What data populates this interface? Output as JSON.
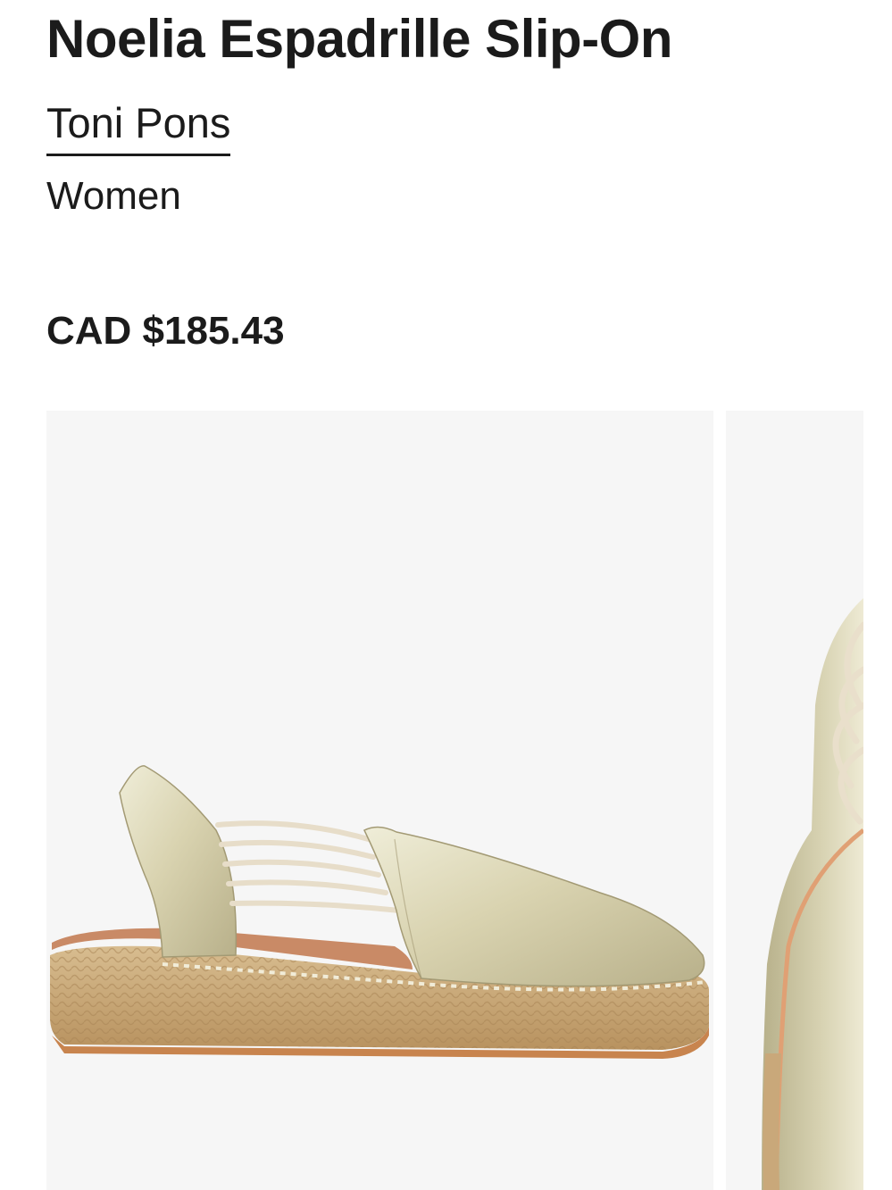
{
  "product": {
    "title": "Noelia Espadrille Slip-On",
    "brand": "Toni Pons",
    "category": "Women",
    "price": "CAD $185.43"
  },
  "gallery": {
    "images": [
      {
        "name": "side-view",
        "alt": "Noelia Espadrille Slip-On side view"
      },
      {
        "name": "close-up-view",
        "alt": "Noelia Espadrille Slip-On close-up"
      }
    ]
  },
  "colors": {
    "text": "#1b1b1b",
    "image_background": "#f6f6f6",
    "metallic_gold": "#d8d3b3",
    "jute": "#c9a87a",
    "cord": "#ece4d2"
  }
}
